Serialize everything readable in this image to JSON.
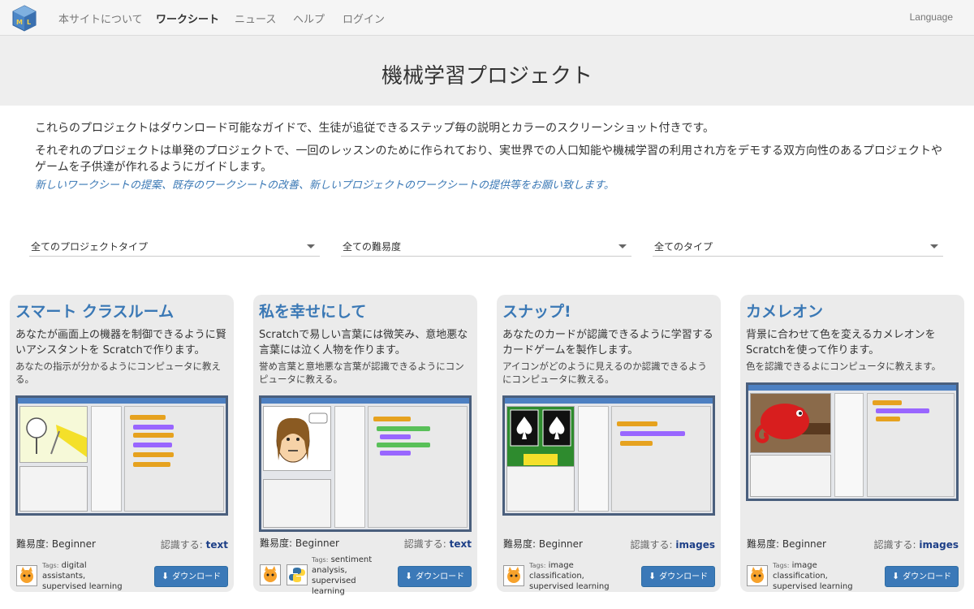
{
  "nav": {
    "items": [
      "本サイトについて",
      "ワークシート",
      "ニュース",
      "ヘルプ",
      "ログイン"
    ],
    "active": "ワークシート",
    "language": "Language"
  },
  "hero": {
    "title": "機械学習プロジェクト"
  },
  "intro": {
    "p1": "これらのプロジェクトはダウンロード可能なガイドで、生徒が追従できるステップ毎の説明とカラーのスクリーンショット付きです。",
    "p2": "それぞれのプロジェクトは単発のプロジェクトで、一回のレッスンのために作られており、実世界での人口知能や機械学習の利用され方をデモする双方向性のあるプロジェクトやゲームを子供達が作れるようにガイドします。",
    "link": "新しいワークシートの提案、既存のワークシートの改善、新しいプロジェクトのワークシートの提供等をお願い致します。"
  },
  "filters": {
    "project_type": "全てのプロジェクトタイプ",
    "difficulty": "全ての難易度",
    "type": "全てのタイプ"
  },
  "labels": {
    "difficulty": "難易度:",
    "recognize": "認識する:",
    "tags": "Tags:",
    "download": "ダウンロード"
  },
  "cards": [
    {
      "title": "スマート クラスルーム",
      "summary": "あなたが画面上の機器を制御できるように賢いアシスタントを Scratchで作ります。",
      "description": "あなたの指示が分かるようにコンピュータに教える。",
      "difficulty": "Beginner",
      "recognizes": "text",
      "tags": "digital assistants, supervised learning",
      "icons": [
        "scratch-cat-icon"
      ]
    },
    {
      "title": "私を幸せにして",
      "summary": "Scratchで易しい言葉には微笑み、意地悪な言葉には泣く人物を作ります。",
      "description": "誉め言葉と意地悪な言葉が認識できるようにコンピュータに教える。",
      "difficulty": "Beginner",
      "recognizes": "text",
      "tags": "sentiment analysis, supervised learning",
      "icons": [
        "scratch-cat-icon",
        "python-icon"
      ]
    },
    {
      "title": "スナップ!",
      "summary": "あなたのカードが認識できるように学習するカードゲームを製作します。",
      "description": "アイコンがどのように見えるのか認識できるようにコンピュータに教える。",
      "difficulty": "Beginner",
      "recognizes": "images",
      "tags": "image classification, supervised learning",
      "icons": [
        "scratch-cat-icon"
      ]
    },
    {
      "title": "カメレオン",
      "summary": "背景に合わせて色を変えるカメレオンを Scratchを使って作ります。",
      "description": "色を認識できるよにコンピュータに教えます。",
      "difficulty": "Beginner",
      "recognizes": "images",
      "tags": "image classification, supervised learning",
      "icons": [
        "scratch-cat-icon"
      ]
    }
  ],
  "colors": {
    "accent": "#3a78b5",
    "button": "#3b79b8",
    "recognize": "#1d3f87",
    "card_bg": "#ebebeb"
  }
}
